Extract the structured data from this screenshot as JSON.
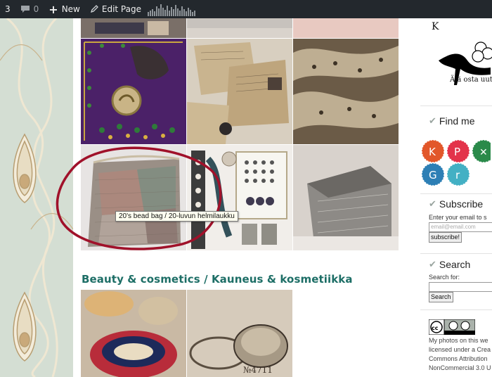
{
  "admin_bar": {
    "site_count": "3",
    "comments_count": "0",
    "new_label": "New",
    "edit_label": "Edit Page"
  },
  "gallery": {
    "tooltip": "20's bead bag / 20-luvun helmilaukku",
    "beauty_heading": "Beauty & cosmetics / Kauneus & kosmetiikka",
    "logo_text": "Älä osta uutt",
    "logo_top_letters": "K"
  },
  "sidebar": {
    "find_me_title": "Find me",
    "subscribe_title": "Subscribe",
    "subscribe_prompt": "Enter your email to s",
    "email_placeholder": "email@email.com",
    "subscribe_button": "subscribe!",
    "search_title": "Search",
    "search_for_label": "Search for:",
    "search_button": "Search",
    "license_line1": "My photos on this we",
    "license_line2": "licensed under a Crea",
    "license_line3": "Commons Attribution",
    "license_line4": "NonCommercial 3.0 U"
  },
  "colors": {
    "admin_bg": "#23282d",
    "heading": "#1d6e66",
    "annotation": "#a0112a"
  }
}
